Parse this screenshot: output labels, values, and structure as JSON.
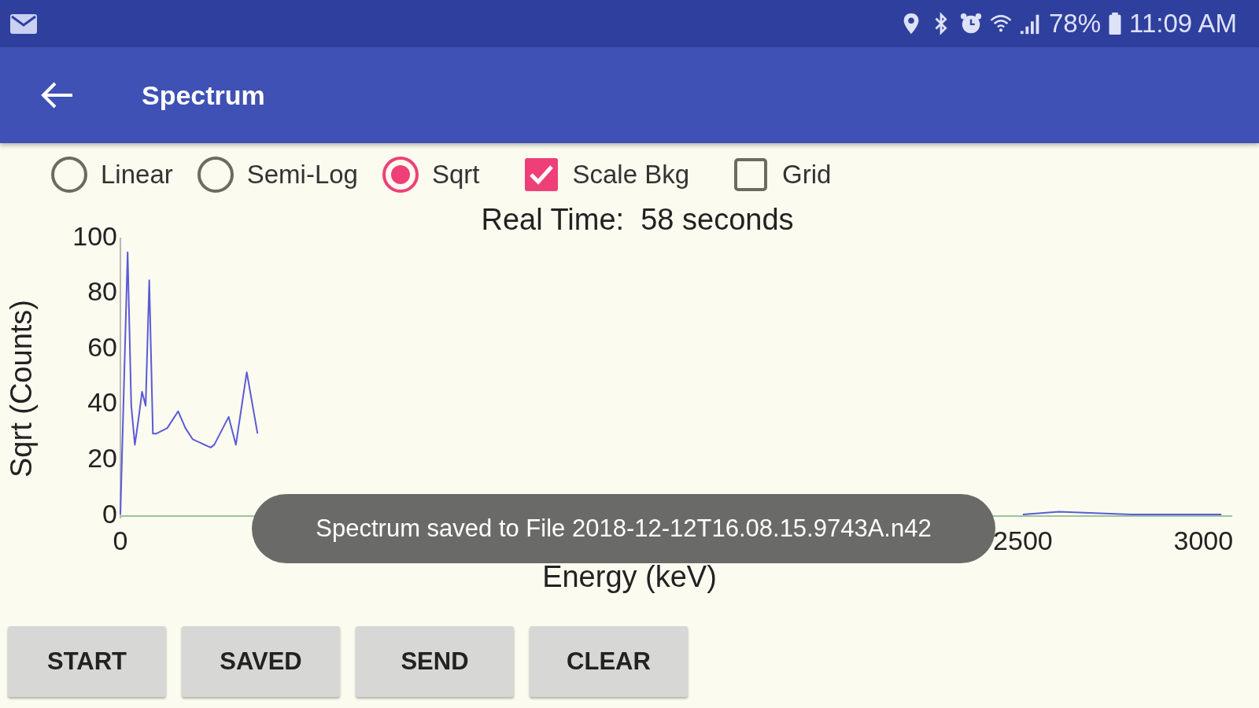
{
  "status_bar": {
    "battery": "78%",
    "time": "11:09 AM"
  },
  "app_bar": {
    "title": "Spectrum"
  },
  "scale_options": [
    {
      "kind": "radio",
      "label": "Linear",
      "selected": false
    },
    {
      "kind": "radio",
      "label": "Semi-Log",
      "selected": false
    },
    {
      "kind": "radio",
      "label": "Sqrt",
      "selected": true
    },
    {
      "kind": "checkbox",
      "label": "Scale Bkg",
      "checked": true
    },
    {
      "kind": "checkbox",
      "label": "Grid",
      "checked": false
    }
  ],
  "chart": {
    "chart_data": {
      "type": "line",
      "title": "Real Time:  58 seconds",
      "xlabel": "Energy (keV)",
      "ylabel": "Sqrt (Counts)",
      "x": [
        0,
        20,
        30,
        40,
        50,
        60,
        70,
        80,
        90,
        100,
        130,
        160,
        180,
        200,
        250,
        260,
        300,
        320,
        350,
        380,
        1500,
        2500,
        2600,
        2800,
        3000,
        3050
      ],
      "series": [
        {
          "color": "#5b5bd6",
          "values": [
            1,
            95,
            40,
            26,
            35,
            45,
            40,
            85,
            30,
            30,
            32,
            38,
            32,
            28,
            25,
            26,
            36,
            26,
            52,
            30,
            null,
            1,
            2,
            1,
            1,
            1
          ]
        }
      ],
      "xlim": [
        0,
        3080
      ],
      "ylim": [
        0,
        100
      ],
      "xticks": [
        0,
        2500,
        3000
      ],
      "yticks": [
        0,
        20,
        40,
        60,
        80,
        100
      ]
    }
  },
  "toast": "Spectrum saved to File 2018-12-12T16.08.15.9743A.n42",
  "buttons": [
    "START",
    "SAVED",
    "SEND",
    "CLEAR"
  ]
}
